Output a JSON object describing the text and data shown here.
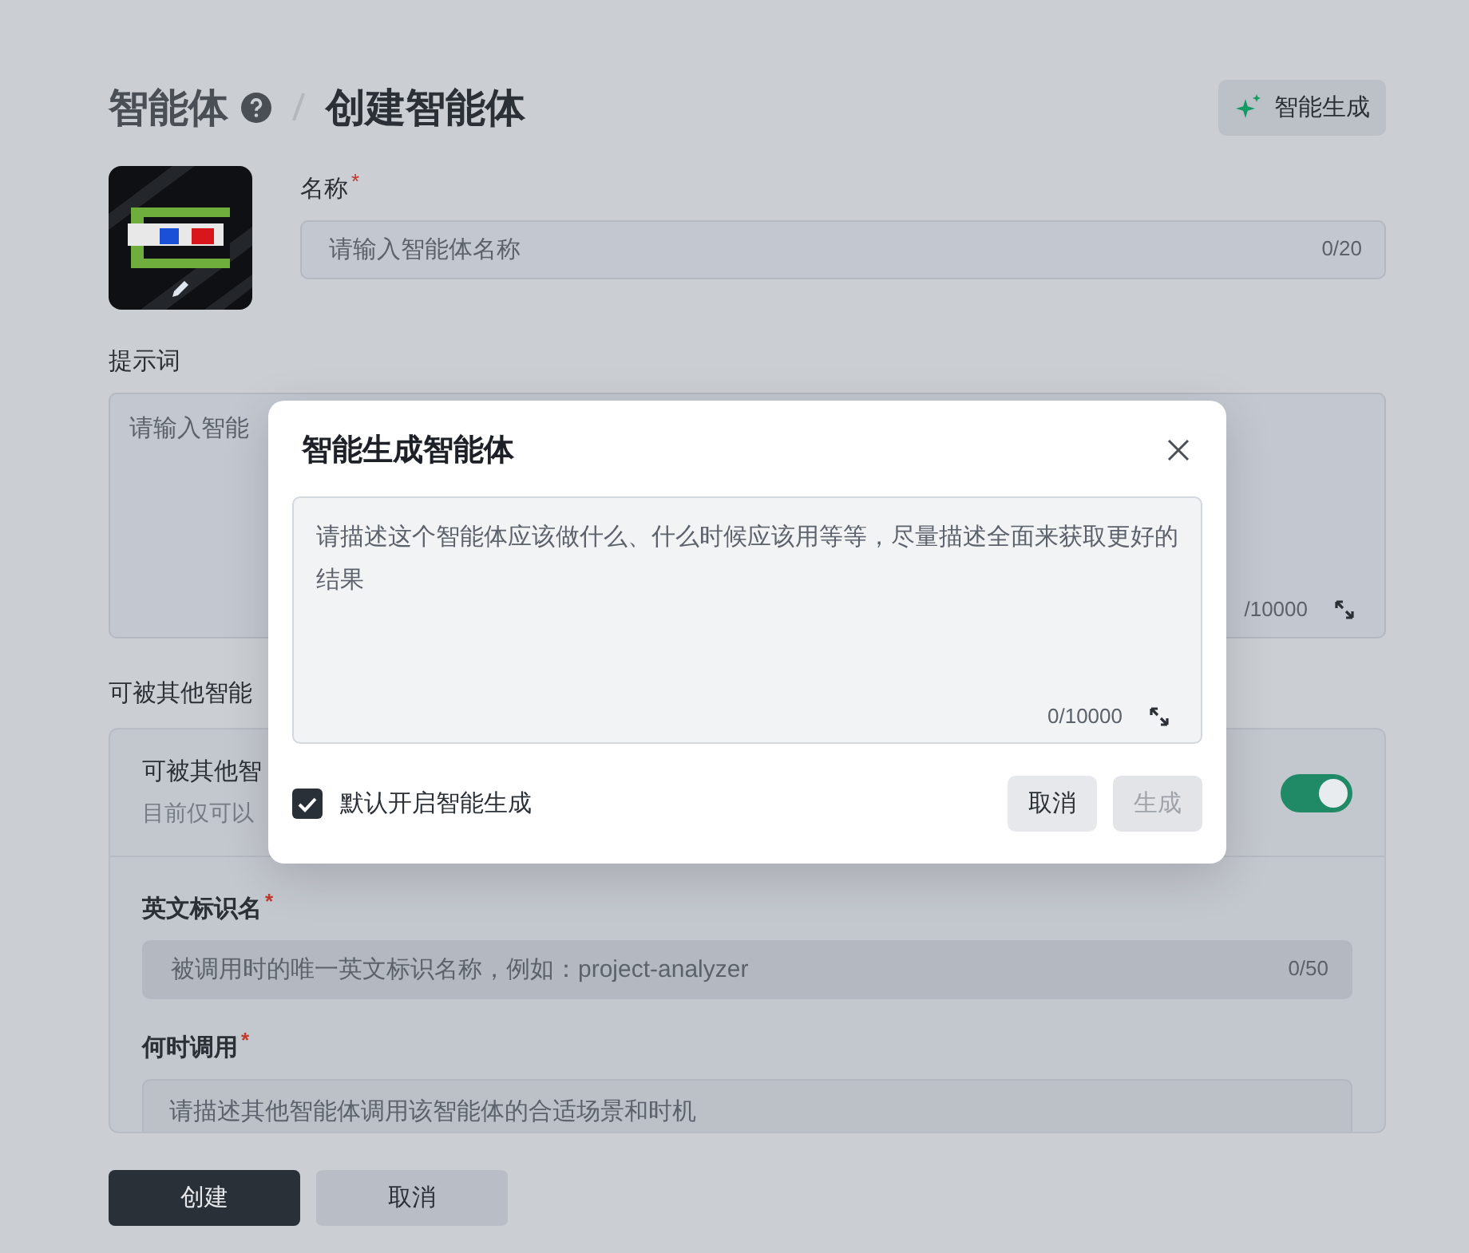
{
  "breadcrumb": [
    {
      "label": "智能体",
      "help": true
    },
    {
      "label": "创建智能体",
      "help": false
    }
  ],
  "header_button": {
    "label": "智能生成"
  },
  "name_field": {
    "label": "名称",
    "required_mark": "*",
    "placeholder": "请输入智能体名称",
    "counter": "0/20"
  },
  "prompt_field": {
    "label": "提示词",
    "placeholder": "请输入智能",
    "counter": "/10000"
  },
  "callable_section": {
    "label": "可被其他智能",
    "toggle": {
      "title": "可被其他智",
      "description": "目前仅可以",
      "on": true
    },
    "fields": [
      {
        "label": "英文标识名",
        "required_mark": "*",
        "placeholder": "被调用时的唯一英文标识名称，例如：project-analyzer",
        "counter": "0/50",
        "kind": "input"
      },
      {
        "label": "何时调用",
        "required_mark": "*",
        "placeholder": "请描述其他智能体调用该智能体的合适场景和时机",
        "kind": "textarea"
      }
    ]
  },
  "footer_buttons": [
    {
      "label": "创建",
      "kind": "primary"
    },
    {
      "label": "取消",
      "kind": "secondary"
    }
  ],
  "dialog": {
    "title": "智能生成智能体",
    "placeholder": "请描述这个智能体应该做什么、什么时候应该用等等，尽量描述全面来获取更好的结果",
    "counter": "0/10000",
    "checkbox": {
      "label": "默认开启智能生成",
      "checked": true
    },
    "buttons": [
      {
        "label": "取消",
        "disabled": false
      },
      {
        "label": "生成",
        "disabled": true
      }
    ]
  }
}
